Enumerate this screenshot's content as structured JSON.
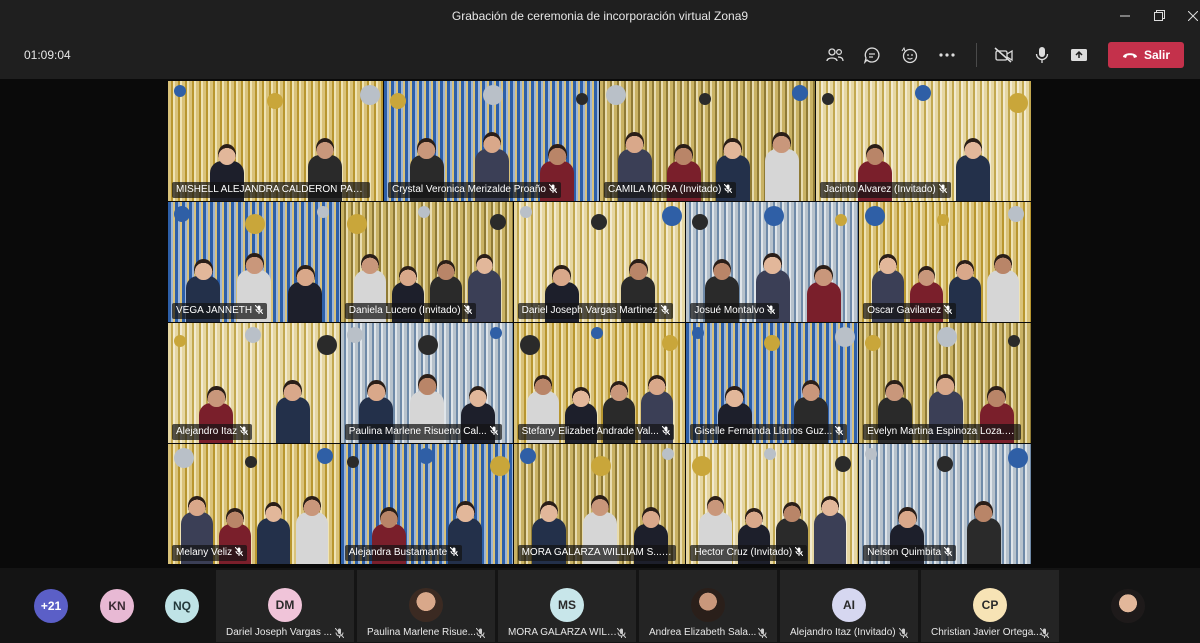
{
  "window": {
    "title": "Grabación de ceremonia de incorporación virtual Zona9"
  },
  "toolbar": {
    "timer": "01:09:04",
    "leave_label": "Salir",
    "icons": [
      "participants-icon",
      "chat-icon",
      "reactions-icon",
      "more-icon",
      "camera-off-icon",
      "microphone-icon",
      "share-screen-icon",
      "phone-hangup-icon"
    ],
    "leave_color": "#c4314b"
  },
  "video_grid": [
    {
      "name": "MISHELL ALEJANDRA CALDERON PAE..."
    },
    {
      "name": "Crystal Veronica Merizalde Proaño"
    },
    {
      "name": "CAMILA MORA (Invitado)"
    },
    {
      "name": "Jacinto Alvarez (Invitado)"
    },
    {
      "name": "VEGA JANNETH"
    },
    {
      "name": "Daniela Lucero (Invitado)"
    },
    {
      "name": "Dariel Joseph Vargas Martinez"
    },
    {
      "name": "Josué Montalvo"
    },
    {
      "name": "Oscar Gavilanez"
    },
    {
      "name": "Alejandro Itaz"
    },
    {
      "name": "Paulina Marlene Risueno Cal..."
    },
    {
      "name": "Stefany Elizabet Andrade Val..."
    },
    {
      "name": "Giselle Fernanda Llanos Guz..."
    },
    {
      "name": "Evelyn Martina Espinoza Loza..."
    },
    {
      "name": "Melany Veliz"
    },
    {
      "name": "Alejandra Bustamante"
    },
    {
      "name": "MORA GALARZA WILLIAM S..."
    },
    {
      "name": "Hector Cruz (Invitado)"
    },
    {
      "name": "Nelson Quimbita"
    }
  ],
  "participants_bar": {
    "overflow_count": "+21",
    "initial_avatars": [
      "KN",
      "NQ"
    ],
    "tiles": [
      {
        "initials": "DM",
        "name": "Dariel Joseph Vargas ..."
      },
      {
        "initials": "",
        "name": "Paulina Marlene Risue..."
      },
      {
        "initials": "MS",
        "name": "MORA GALARZA WILL..."
      },
      {
        "initials": "",
        "name": "Andrea Elizabeth Sala..."
      },
      {
        "initials": "AI",
        "name": "Alejandro Itaz (Invitado)"
      },
      {
        "initials": "CP",
        "name": "Christian Javier Ortega..."
      }
    ]
  },
  "scene": {
    "gold": "#c9a63a",
    "silver": "#b9c0c8",
    "blue": "#2e6bb8"
  }
}
